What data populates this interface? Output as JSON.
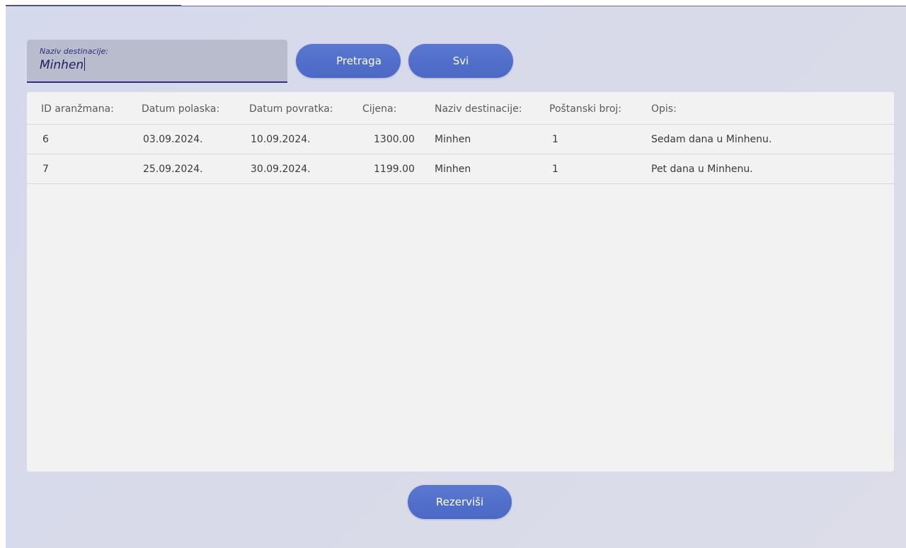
{
  "search": {
    "label": "Naziv destinacije:",
    "value": "Minhen"
  },
  "buttons": {
    "search_label": "Pretraga",
    "all_label": "Svi",
    "reserve_label": "Rezerviši"
  },
  "table": {
    "headers": [
      "ID aranžmana:",
      "Datum polaska:",
      "Datum povratka:",
      "Cijena:",
      "Naziv destinacije:",
      "Poštanski broj:",
      "Opis:"
    ],
    "rows": [
      [
        "6",
        "03.09.2024.",
        "10.09.2024.",
        "1300.00",
        "Minhen",
        "1",
        "Sedam dana u Minhenu."
      ],
      [
        "7",
        "25.09.2024.",
        "30.09.2024.",
        "1199.00",
        "Minhen",
        "1",
        "Pet dana u Minhenu."
      ]
    ]
  },
  "colors": {
    "accent": "#4a68c5",
    "field_underline": "#2e2d8e"
  }
}
